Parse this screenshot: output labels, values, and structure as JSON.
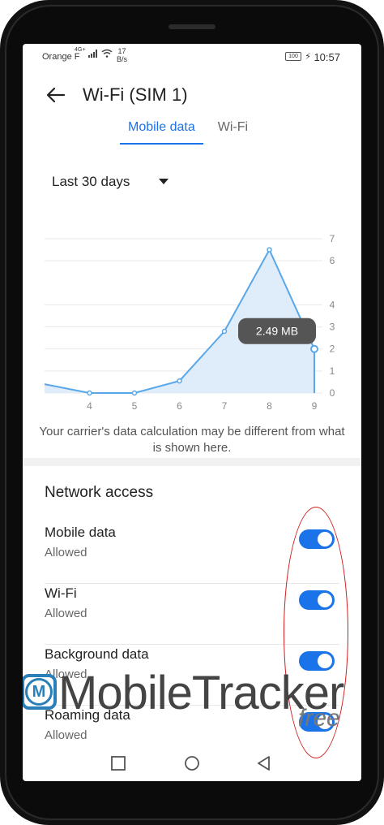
{
  "status_bar": {
    "carrier": "Orange F",
    "network": "4G+",
    "speed_value": "17",
    "speed_unit": "B/s",
    "battery": "100",
    "time": "10:57"
  },
  "header": {
    "title": "Wi-Fi (SIM 1)",
    "back_icon": "arrow-left-icon"
  },
  "tabs": [
    {
      "label": "Mobile data",
      "active": true
    },
    {
      "label": "Wi-Fi",
      "active": false
    }
  ],
  "period": {
    "selected": "Last 30 days"
  },
  "chart_data": {
    "type": "area",
    "x": [
      3,
      4,
      5,
      6,
      7,
      8,
      9
    ],
    "y": [
      0.4,
      0,
      0,
      0.55,
      2.8,
      6.5,
      2.0
    ],
    "xticks": [
      "4",
      "5",
      "6",
      "7",
      "8",
      "9"
    ],
    "yticks": [
      "0",
      "1",
      "2",
      "3",
      "4",
      "6",
      "7"
    ],
    "ylim": [
      0,
      7
    ],
    "xlim": [
      3,
      9
    ],
    "grid": true,
    "tooltip": "2.49 MB",
    "colors": {
      "line": "#5aa7e8",
      "fill": "#dcebfb",
      "tooltip_bg": "#555555"
    }
  },
  "disclaimer": "Your carrier's data calculation may be different from what is shown here.",
  "network_access": {
    "title": "Network access",
    "items": [
      {
        "title": "Mobile data",
        "status": "Allowed",
        "enabled": true
      },
      {
        "title": "Wi-Fi",
        "status": "Allowed",
        "enabled": true
      },
      {
        "title": "Background data",
        "status": "Allowed",
        "enabled": true
      },
      {
        "title": "Roaming data",
        "status": "Allowed",
        "enabled": true
      }
    ]
  },
  "watermark": {
    "brand": "MobileTracker",
    "suffix": "free",
    "logo_letter": "M"
  },
  "colors": {
    "accent": "#1a73e8",
    "annotation": "#cf1b1b"
  }
}
